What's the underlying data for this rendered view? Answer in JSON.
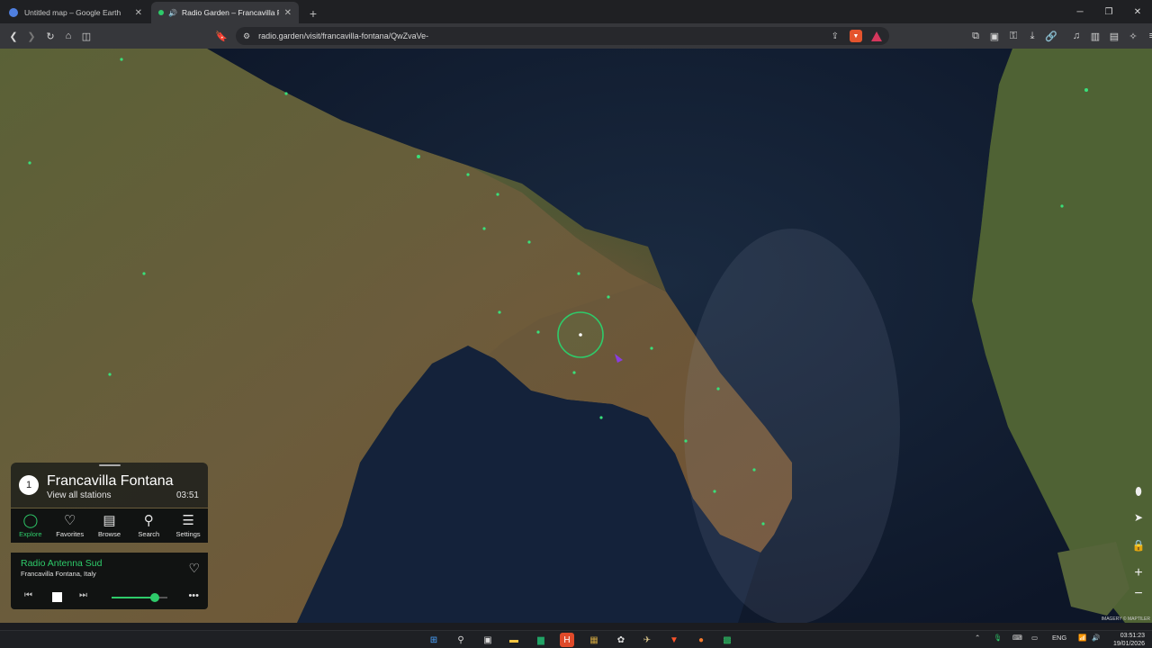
{
  "browser": {
    "tabs": [
      {
        "title": "Untitled map – Google Earth",
        "active": false
      },
      {
        "title": "Radio Garden – Francavilla Fo",
        "active": true
      }
    ],
    "url": "radio.garden/visit/francavilla-fontana/QwZvaVe-"
  },
  "location": {
    "count": "1",
    "name": "Francavilla Fontana",
    "view_all": "View all stations",
    "time": "03:51"
  },
  "nav": {
    "explore": "Explore",
    "favorites": "Favorites",
    "browse": "Browse",
    "search": "Search",
    "settings": "Settings"
  },
  "player": {
    "station": "Radio Antenna Sud",
    "station_location": "Francavilla Fontana, Italy",
    "volume_percent": 78
  },
  "map": {
    "attribution": "IMAGERY © MAPTILER",
    "accent_color": "#2ecb6a"
  },
  "taskbar": {
    "lang": "ENG",
    "time": "03:51:23",
    "date": "19/01/2026"
  }
}
